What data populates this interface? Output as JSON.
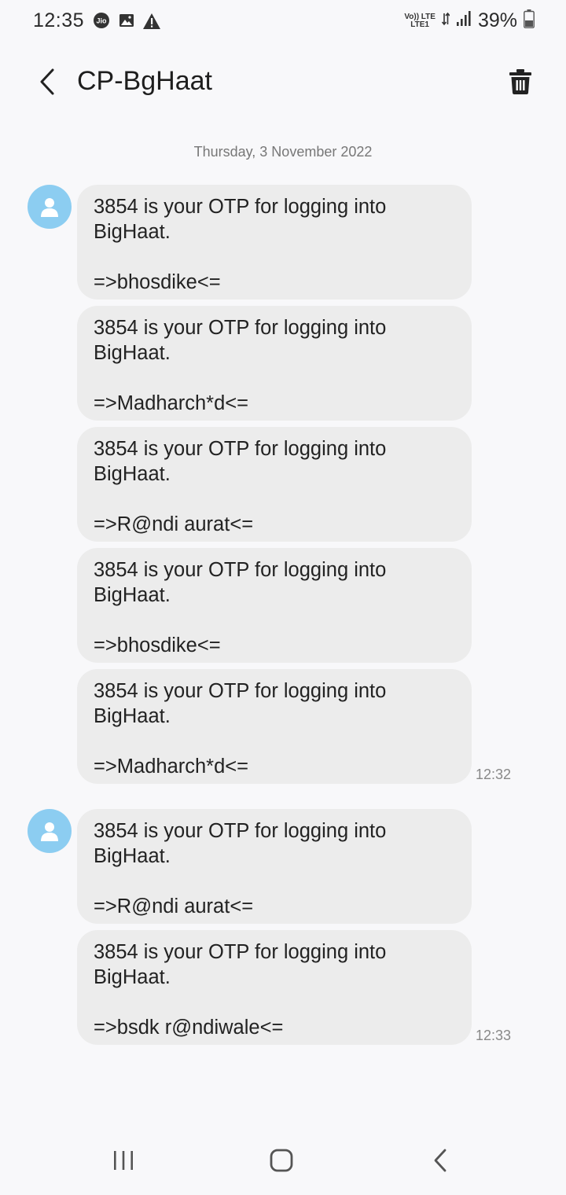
{
  "status_bar": {
    "time": "12:35",
    "net_line1": "Vo)) LTE",
    "net_line2": "LTE1",
    "battery": "39%"
  },
  "header": {
    "title": "CP-BgHaat"
  },
  "conversation": {
    "date": "Thursday, 3 November 2022",
    "messages": [
      {
        "text": "3854 is your OTP for logging into BigHaat.\n\n=>bhosdike<="
      },
      {
        "text": "3854 is your OTP for logging into BigHaat.\n\n=>Madharch*d<="
      },
      {
        "text": "3854 is your OTP for logging into BigHaat.\n\n=>R@ndi aurat<="
      },
      {
        "text": "3854 is your OTP for logging into BigHaat.\n\n=>bhosdike<="
      },
      {
        "text": "3854 is your OTP for logging into BigHaat.\n\n=>Madharch*d<=",
        "time": "12:32"
      },
      {
        "text": "3854 is your OTP for logging into BigHaat.\n\n=>R@ndi aurat<="
      },
      {
        "text": "3854 is your OTP for logging into BigHaat.\n\n=>bsdk r@ndiwale<=",
        "time": "12:33"
      }
    ]
  },
  "colors": {
    "bubble": "#ececec",
    "avatar": "#8ccdf1",
    "background": "#f8f8fa"
  },
  "icons": {
    "back": "chevron-left-icon",
    "delete": "trash-icon",
    "avatar": "person-icon",
    "nav_recents": "recents-icon",
    "nav_home": "home-icon",
    "nav_back": "back-icon"
  }
}
